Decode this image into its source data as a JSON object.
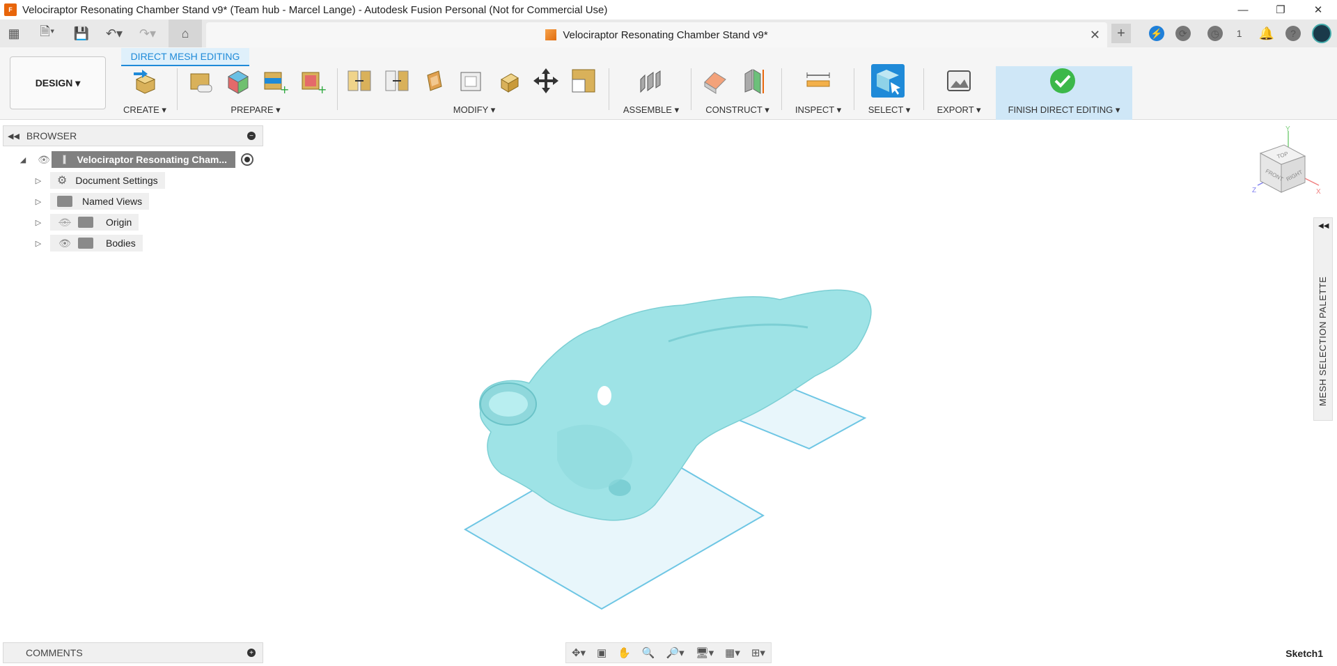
{
  "window": {
    "title": "Velociraptor Resonating Chamber Stand v9* (Team hub - Marcel Lange) - Autodesk Fusion Personal (Not for Commercial Use)",
    "controls": [
      "minimize-icon",
      "restore-icon",
      "close-icon"
    ]
  },
  "tabbar": {
    "doc_title": "Velociraptor Resonating Chamber Stand v9*",
    "job_count": "1"
  },
  "toolbar": {
    "workspace": "DESIGN",
    "mode_tab": "DIRECT MESH EDITING",
    "groups": {
      "create": "CREATE",
      "prepare": "PREPARE",
      "modify": "MODIFY",
      "assemble": "ASSEMBLE",
      "construct": "CONSTRUCT",
      "inspect": "INSPECT",
      "select": "SELECT",
      "export": "EXPORT",
      "finish": "FINISH DIRECT EDITING"
    }
  },
  "browser": {
    "title": "BROWSER",
    "root": "Velociraptor Resonating Cham...",
    "items": [
      {
        "label": "Document Settings"
      },
      {
        "label": "Named Views"
      },
      {
        "label": "Origin"
      },
      {
        "label": "Bodies"
      }
    ]
  },
  "comments": {
    "title": "COMMENTS"
  },
  "palette": {
    "title": "MESH SELECTION PALETTE"
  },
  "viewcube": {
    "top": "TOP",
    "front": "FRONT",
    "right": "RIGHT",
    "axis_x": "X",
    "axis_y": "Y",
    "axis_z": "Z"
  },
  "status": {
    "active_sketch": "Sketch1"
  },
  "colors": {
    "accent": "#1f8ad8",
    "mesh": "#9ee3e6",
    "plane": "#e8f6fb",
    "finish_bg": "#cfe7f7",
    "check": "#3cb84a"
  }
}
